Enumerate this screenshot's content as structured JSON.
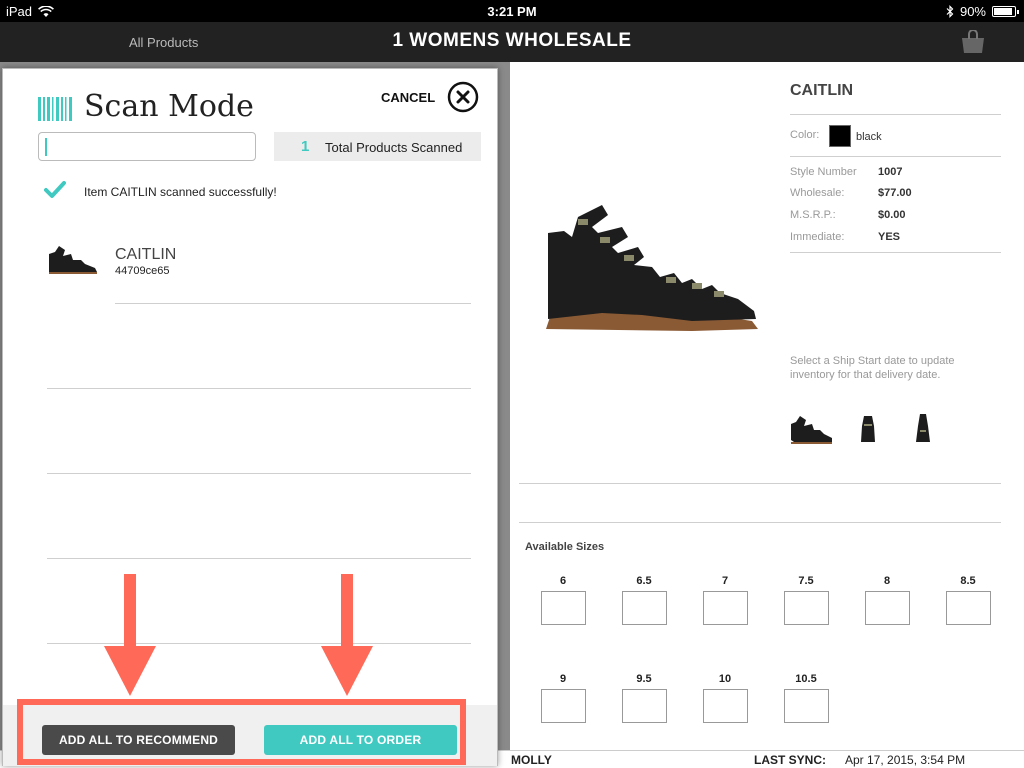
{
  "status_bar": {
    "device": "iPad",
    "time": "3:21 PM",
    "battery": "90%",
    "battery_level": 0.9
  },
  "nav": {
    "back_label": "All Products",
    "title": "1 WOMENS WHOLESALE",
    "bag_icon": "shopping-bag-icon"
  },
  "modal": {
    "title": "Scan Mode",
    "cancel_label": "CANCEL",
    "input_value": "",
    "total_count": "1",
    "total_label": "Total Products Scanned",
    "success_message": "Item CAITLIN scanned successfully!",
    "items": [
      {
        "name": "CAITLIN",
        "code": "44709ce65"
      }
    ],
    "buttons": {
      "recommend": "ADD ALL TO RECOMMEND",
      "order": "ADD ALL TO ORDER"
    }
  },
  "product": {
    "name": "CAITLIN",
    "color_label": "Color:",
    "color_value": "black",
    "color_hex": "#000000",
    "specs": [
      {
        "label": "Style Number",
        "value": "1007"
      },
      {
        "label": "Wholesale:",
        "value": "$77.00"
      },
      {
        "label": "M.S.R.P.:",
        "value": "$0.00"
      },
      {
        "label": "Immediate:",
        "value": "YES"
      }
    ],
    "ship_note": "Select a Ship Start date to update inventory for that delivery date.",
    "available_sizes_label": "Available Sizes",
    "sizes": [
      "6",
      "6.5",
      "7",
      "7.5",
      "8",
      "8.5",
      "9",
      "9.5",
      "10",
      "10.5"
    ]
  },
  "footer": {
    "user": "MOLLY",
    "sync_label": "LAST SYNC:",
    "sync_value": "Apr 17, 2015, 3:54 PM"
  },
  "colors": {
    "accent": "#3fc9c0",
    "annotation": "#ff6a58",
    "nav_bg": "#222222",
    "dark_button": "#4a4a4a"
  }
}
